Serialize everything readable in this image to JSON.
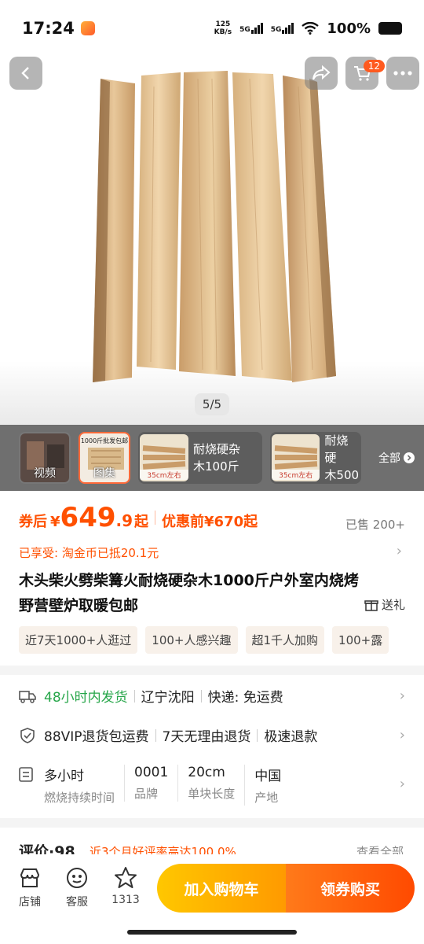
{
  "status": {
    "time": "17:24",
    "speed_top": "125",
    "speed_bottom": "KB/s",
    "net1": "5G",
    "net2": "5G",
    "battery": "100%"
  },
  "gallery": {
    "counter": "5/5",
    "cart_count": "12"
  },
  "thumbs": [
    {
      "label": "视频"
    },
    {
      "label": "图集",
      "caption": "1000斤批发包邮"
    },
    {
      "name": "耐烧硬杂\n木100斤",
      "line1": "耐烧硬杂",
      "line2": "木100斤",
      "caption": "35cm左右"
    },
    {
      "line1": "耐烧硬",
      "line2": "木500",
      "caption": "35cm左右"
    }
  ],
  "thumbs_all": "全部",
  "price": {
    "prefix": "券后",
    "currency": "¥",
    "integer": "649",
    "decimal": ".9",
    "suffix": "起",
    "before_label": "优惠前¥670起",
    "sold": "已售 200+"
  },
  "coin_text": "已享受: 淘金币已抵20.1元",
  "title": "木头柴火劈柴篝火耐烧硬杂木1000斤户外室内烧烤野营壁炉取暖包邮",
  "gift": "送礼",
  "tags": [
    "近7天1000+人逛过",
    "100+人感兴趣",
    "超1千人加购",
    "100+露"
  ],
  "shipping": {
    "dispatch": "48小时内发货",
    "origin": "辽宁沈阳",
    "express": "快递: 免运费",
    "svc1": "88VIP退货包运费",
    "svc2": "7天无理由退货",
    "svc3": "极速退款"
  },
  "specs": [
    {
      "value": "多小时",
      "key": "燃烧持续时间"
    },
    {
      "value": "0001",
      "key": "品牌"
    },
    {
      "value": "20cm",
      "key": "单块长度"
    },
    {
      "value": "中国",
      "key": "产地"
    }
  ],
  "rating": {
    "label": "评价·98",
    "summary": "近3个月好评率高达100.0%",
    "all": "查看全部"
  },
  "bottom": {
    "shop": "店铺",
    "service": "客服",
    "fav_count": "1313",
    "add_cart": "加入购物车",
    "buy": "领券购买"
  },
  "colors": {
    "accent": "#ff5000",
    "green": "#27a64a",
    "cart_btn": "#ffb300",
    "buy_btn": "#ff5a00"
  }
}
